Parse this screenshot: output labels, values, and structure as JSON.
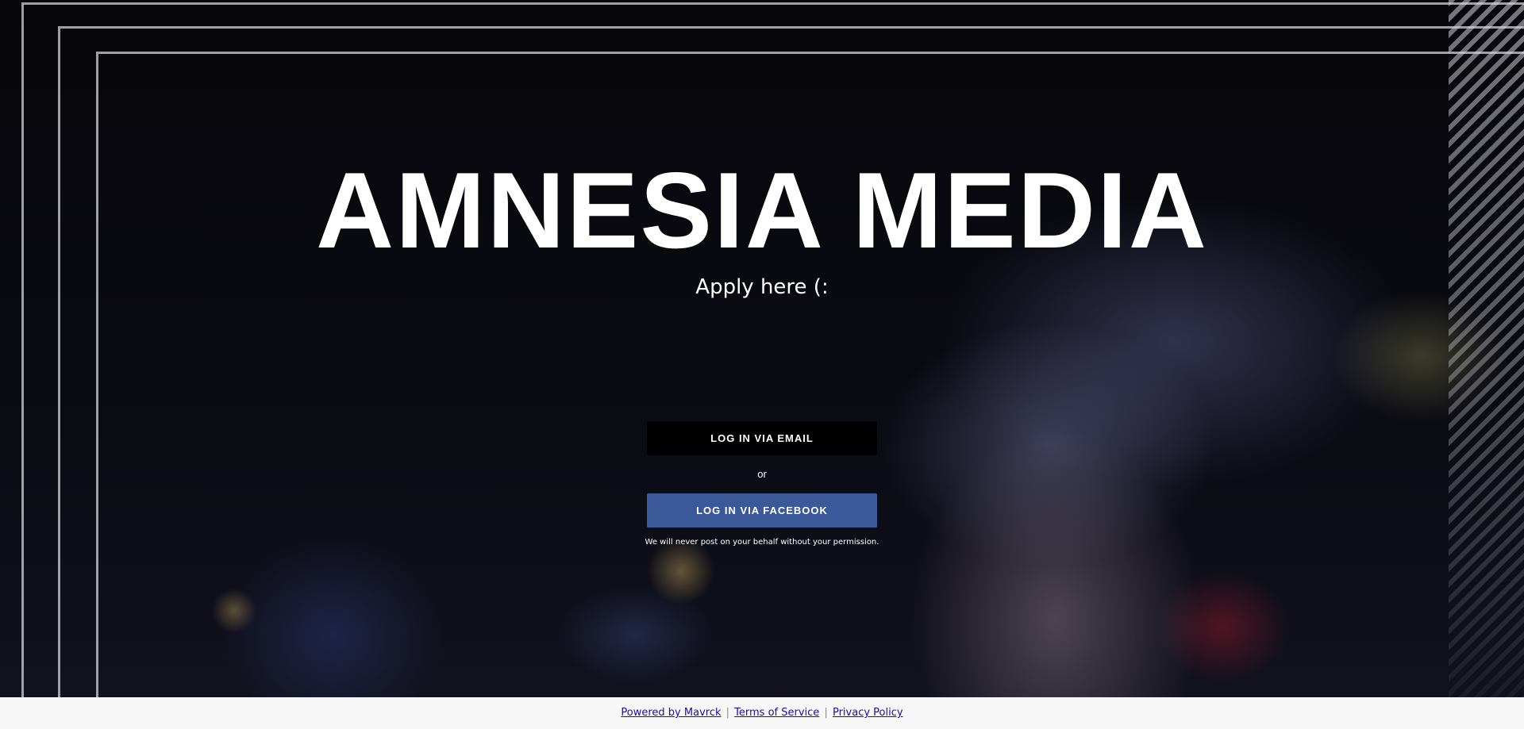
{
  "hero": {
    "title": "AMNESIA MEDIA",
    "subtitle": "Apply here (:",
    "background_description_colors": {
      "base": "#0b0b10",
      "smoke": "#8c8fc8",
      "frame_lines": "#d2d2d7"
    }
  },
  "login": {
    "email_button_label": "LOG IN VIA EMAIL",
    "or_text": "or",
    "facebook_button_label": "LOG IN VIA FACEBOOK",
    "disclaimer": "We will never post on your behalf without your permission.",
    "email_button_color": "#000000",
    "facebook_button_color": "#3b5998"
  },
  "footer": {
    "powered_by": "Powered by Mavrck",
    "separator": "|",
    "terms": "Terms of Service",
    "privacy": "Privacy Policy",
    "link_color": "#1a0dab"
  }
}
